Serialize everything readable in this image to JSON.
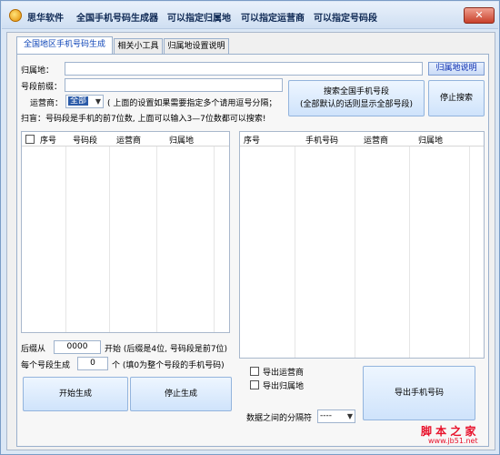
{
  "titlebar": {
    "app_name": "思华软件",
    "items": [
      "全国手机号码生成器",
      "可以指定归属地",
      "可以指定运营商",
      "可以指定号码段"
    ],
    "close_glyph": "✕"
  },
  "tabs": [
    "全国地区手机号码生成",
    "相关小工具",
    "归属地设置说明"
  ],
  "form": {
    "location_label": "归属地：",
    "location_value": "",
    "location_help_button": "归属地说明",
    "prefix_label": "号段前缀：",
    "prefix_value": "",
    "carrier_label": "运营商：",
    "carrier_value": "全部",
    "carrier_note": "( 上面的设置如果需要指定多个请用逗号分隔；",
    "hint": "扫盲：号码段是手机的前7位数, 上面可以输入3—7位数都可以搜索!"
  },
  "search_button": {
    "line1": "搜索全国手机号段",
    "line2": "(全部默认的话则显示全部号段)"
  },
  "stop_search_button": "停止搜索",
  "left_list": {
    "columns": [
      "序号",
      "号码段",
      "运营商",
      "归属地"
    ]
  },
  "right_list": {
    "columns": [
      "序号",
      "手机号码",
      "运营商",
      "归属地"
    ]
  },
  "generate": {
    "suffix_from_label": "后缀从",
    "suffix_from_value": "0000",
    "suffix_from_note": "开始 (后缀是4位, 号码段是前7位)",
    "per_segment_label": "每个号段生成",
    "per_segment_value": "0",
    "per_segment_note": "个 (填0为整个号段的手机号码)",
    "start_button": "开始生成",
    "stop_button": "停止生成"
  },
  "export": {
    "carrier_checkbox": "导出运营商",
    "location_checkbox": "导出归属地",
    "separator_label": "数据之间的分隔符",
    "separator_value": "----",
    "export_button": "导出手机号码"
  },
  "watermark": {
    "brand": "脚 本 之 家",
    "url": "www.jb51.net"
  },
  "colors": {
    "title_text": "#102a55",
    "tab_active_text": "#1047b8",
    "watermark": "#e8102a",
    "selected": "#2a5aa8"
  }
}
